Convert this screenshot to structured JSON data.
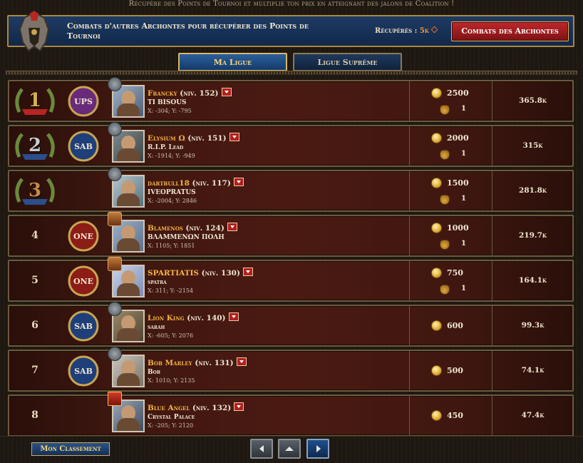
{
  "header": {
    "message": "Récupère des Points de Tournoi et multiplie ton prix en atteignant des jalons de Coalition !",
    "banner_text": "Combats d'autres Archontes pour récupérer des Points de Tournoi",
    "collected_label": "Récupérés :",
    "collected_value": "5k",
    "archons_button": "Combats des Archontes"
  },
  "tabs": [
    {
      "label": "Ma Ligue",
      "active": true
    },
    {
      "label": "Ligue Suprême",
      "active": false
    }
  ],
  "rows": [
    {
      "rank": "1",
      "alliance_tag": "UPS",
      "shield_color": "#6a2a7a",
      "name": "Francky",
      "level": "(niv. 152)",
      "alliance": "TI BISOUS",
      "coords": "X: -304; Y: -795",
      "points": "2500",
      "bags": "1",
      "might": "365.8k"
    },
    {
      "rank": "2",
      "alliance_tag": "SAB",
      "shield_color": "#1e3f7a",
      "name": "Elysium Ω",
      "level": "(niv. 151)",
      "alliance": "R.I.P.  Lead",
      "coords": "X: -1914; Y: -949",
      "points": "2000",
      "bags": "1",
      "might": "315k"
    },
    {
      "rank": "3",
      "alliance_tag": "",
      "shield_color": "",
      "name": "dartbull18",
      "level": "(niv. 117)",
      "alliance": "IVEOPRATUS",
      "coords": "X: -2004; Y: 2846",
      "points": "1500",
      "bags": "1",
      "might": "281.8k"
    },
    {
      "rank": "4",
      "alliance_tag": "ONE",
      "shield_color": "#8c1c16",
      "name": "Blamenos",
      "level": "(niv. 124)",
      "alliance": "ΒΛΑΜΜΕΝΩΝ ΠΟΛΗ",
      "coords": "X: 1105; Y: 1851",
      "points": "1000",
      "bags": "1",
      "might": "219.7k"
    },
    {
      "rank": "5",
      "alliance_tag": "ONE",
      "shield_color": "#8c1c16",
      "name": "SPARTIATIS",
      "level": "(niv. 130)",
      "alliance": "spatra",
      "coords": "X: 311; Y: -2154",
      "points": "750",
      "bags": "1",
      "might": "164.1k"
    },
    {
      "rank": "6",
      "alliance_tag": "SAB",
      "shield_color": "#1e3f7a",
      "name": "Lion King",
      "level": "(niv. 140)",
      "alliance": "sarah",
      "coords": "X: -605; Y: 2076",
      "points": "600",
      "bags": "",
      "might": "99.3k"
    },
    {
      "rank": "7",
      "alliance_tag": "SAB",
      "shield_color": "#1e3f7a",
      "name": "Bob Marley",
      "level": "(niv. 131)",
      "alliance": "Bob",
      "coords": "X: 1010; Y: 2135",
      "points": "500",
      "bags": "",
      "might": "74.1k"
    },
    {
      "rank": "8",
      "alliance_tag": "",
      "shield_color": "",
      "name": "Blue Angel",
      "level": "(niv. 132)",
      "alliance": "Crystal Palace",
      "coords": "X: -205; Y: 2120",
      "points": "450",
      "bags": "",
      "might": "47.4k"
    }
  ],
  "footer": {
    "my_rank_button": "Mon Classement"
  },
  "colors": {
    "gold": "#f5b341",
    "accent_red": "#b0201e",
    "blue": "#1f3b63"
  }
}
